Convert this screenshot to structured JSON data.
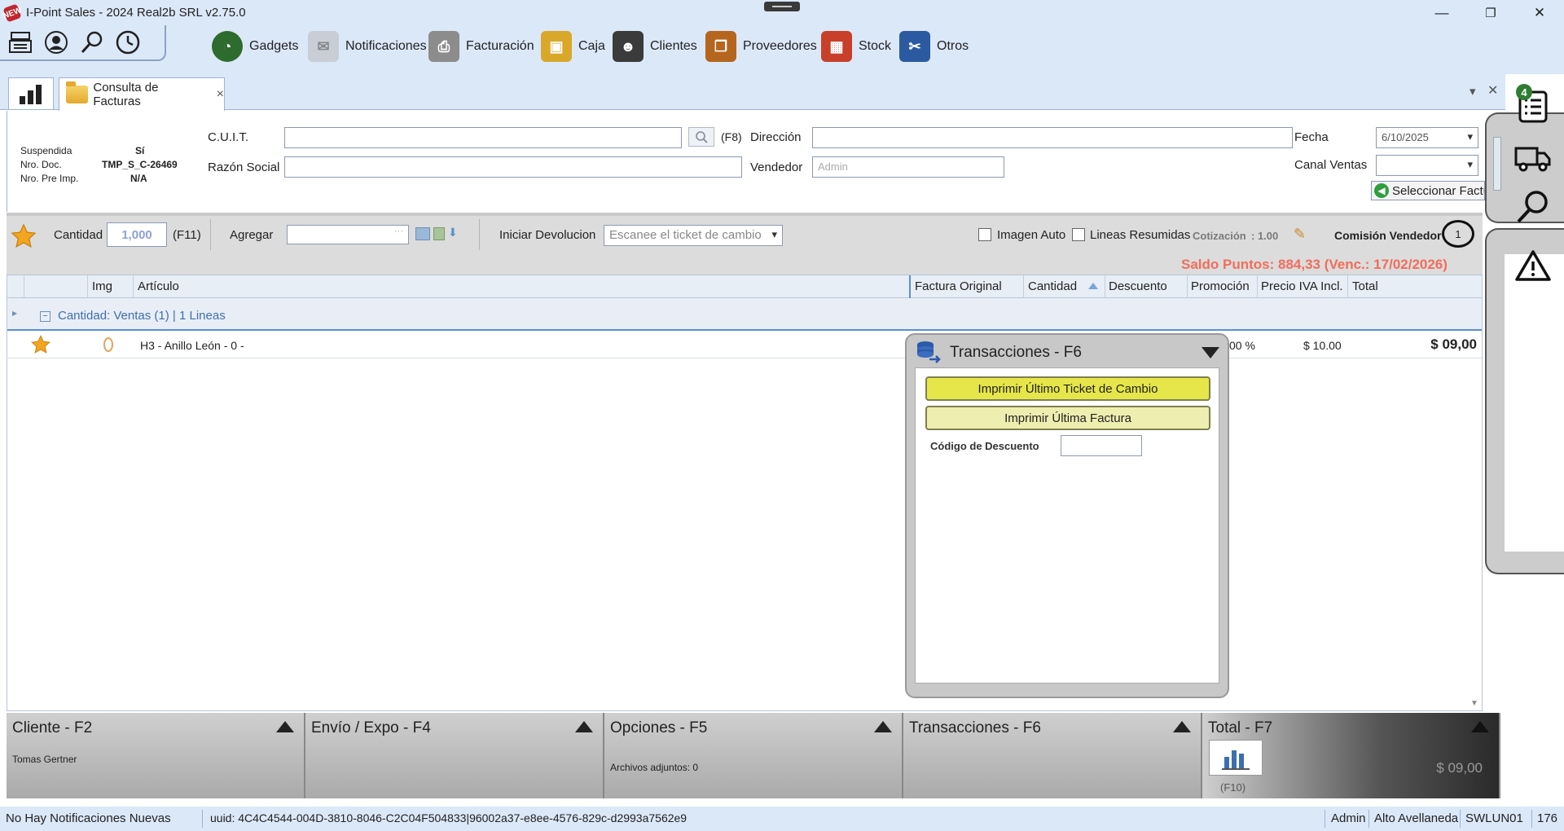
{
  "window": {
    "title": "I-Point Sales  - 2024 Real2b SRL v2.75.0",
    "app_icon_text": "NEW",
    "minimize": "—",
    "restore": "❐",
    "close": "✕"
  },
  "toolbar": {
    "quick_icons": [
      "cash-register-icon",
      "user-icon",
      "search-icon",
      "clock-icon"
    ],
    "menu": [
      {
        "label": "Gadgets",
        "icon": "gauge-icon",
        "color": "#2e6b2e"
      },
      {
        "label": "Notificaciones",
        "icon": "envelope-icon",
        "color": "#c9ced6"
      },
      {
        "label": "Facturación",
        "icon": "printer-icon",
        "color": "#8c8c8c"
      },
      {
        "label": "Caja",
        "icon": "safe-icon",
        "color": "#d9a72a"
      },
      {
        "label": "Clientes",
        "icon": "person-icon",
        "color": "#3b3b3b"
      },
      {
        "label": "Proveedores",
        "icon": "supplier-icon",
        "color": "#b5651d"
      },
      {
        "label": "Stock",
        "icon": "boxes-icon",
        "color": "#c8402a"
      },
      {
        "label": "Otros",
        "icon": "tools-icon",
        "color": "#2c5aa0"
      }
    ]
  },
  "tabs": {
    "active_label": "Consulta de Facturas",
    "close": "×",
    "collapse": "▾",
    "close_all": "✕"
  },
  "header": {
    "suspendida_label": "Suspendida",
    "suspendida_value": "Sí",
    "nro_doc_label": "Nro. Doc.",
    "nro_doc_value": "TMP_S_C-26469",
    "nro_pre_label": "Nro. Pre Imp.",
    "nro_pre_value": "N/A",
    "cuit_label": "C.U.I.T.",
    "cuit_value": "",
    "cuit_shortcut": "(F8)",
    "razon_label": "Razón Social",
    "razon_value": "",
    "direccion_label": "Dirección",
    "direccion_value": "",
    "vendedor_label": "Vendedor",
    "vendedor_placeholder": "Admin",
    "fecha_label": "Fecha",
    "fecha_value": "6/10/2025",
    "canal_label": "Canal Ventas",
    "canal_value": "",
    "seleccionar_label": "Seleccionar Factu"
  },
  "actionbar": {
    "cantidad_label": "Cantidad",
    "cantidad_value": "1,000",
    "cantidad_shortcut": "(F11)",
    "agregar_label": "Agregar",
    "agregar_value": "",
    "agregar_ellipsis": "···",
    "devolucion_label": "Iniciar Devolucion",
    "devolucion_placeholder": "Escanee el ticket de cambio",
    "imagen_auto": "Imagen Auto",
    "lineas_resumidas": "Lineas Resumidas",
    "cotizacion_label": "Cotización",
    "cotizacion_value": ": 1.00",
    "comision_label": "Comisión Vendedor",
    "comision_value": "1",
    "saldo_puntos": "Saldo Puntos: 884,33 (Venc.: 17/02/2026)",
    "saldo_color": "#f26d5b"
  },
  "grid": {
    "columns": [
      "Img",
      "Artículo",
      "Factura Original",
      "Cantidad",
      "Descuento",
      "Promoción",
      "Precio IVA Incl.",
      "Total"
    ],
    "group_label": "Cantidad: Ventas (1) | 1 Lineas",
    "group_toggle": "−",
    "rows": [
      {
        "articulo": "H3 - Anillo León - 0 -",
        "promocion": "00 %",
        "precio": "$ 10.00",
        "total": "$ 09,00"
      }
    ]
  },
  "popup": {
    "title": "Transacciones - F6",
    "btn_ticket": "Imprimir Último Ticket de Cambio",
    "btn_factura": "Imprimir Última Factura",
    "codigo_label": "Código de Descuento",
    "codigo_value": "",
    "btn_ticket_color": "#e6e64a",
    "btn_factura_color": "#eeeeb0"
  },
  "bottom": {
    "cliente_title": "Cliente - F2",
    "cliente_value": "Tomas Gertner",
    "envio_title": "Envío / Expo - F4",
    "opciones_title": "Opciones - F5",
    "opciones_value": "Archivos adjuntos: 0",
    "transacciones_title": "Transacciones - F6",
    "total_title": "Total - F7",
    "total_value": "$ 09,00",
    "total_shortcut": "(F10)"
  },
  "statusbar": {
    "notificaciones": "No Hay Notificaciones Nuevas",
    "uuid": "uuid: 4C4C4544-004D-3810-8046-C2C04F504833|96002a37-e8ee-4576-829c-d2993a7562e9",
    "user": "Admin",
    "branch": "Alto Avellaneda",
    "terminal": "SWLUN01",
    "number": "176"
  },
  "rightpanel": {
    "badge": "4",
    "icons": [
      "list-icon",
      "truck-icon",
      "search-icon",
      "warning-icon"
    ]
  }
}
